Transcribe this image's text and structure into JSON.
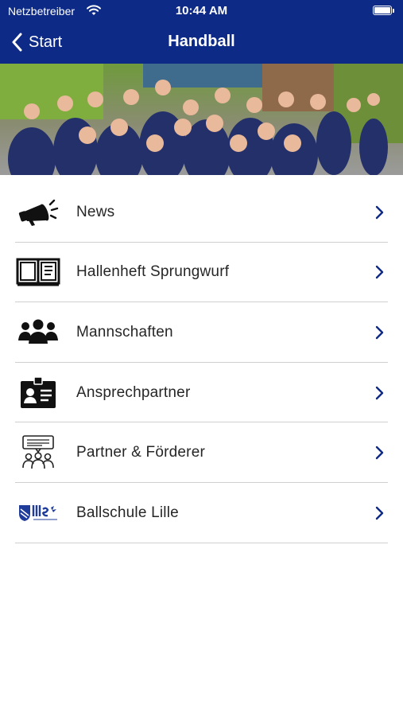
{
  "status_bar": {
    "carrier": "Netzbetreiber",
    "time": "10:44 AM",
    "battery_level": 1.0
  },
  "nav": {
    "back_label": "Start",
    "title": "Handball"
  },
  "hero": {
    "description_icon": "team-photo"
  },
  "colors": {
    "nav_background": "#0d2a86",
    "chevron": "#0d2a86",
    "text": "#262626"
  },
  "menu": [
    {
      "label": "News",
      "icon": "megaphone-icon"
    },
    {
      "label": "Hallenheft Sprungwurf",
      "icon": "open-book-icon"
    },
    {
      "label": "Mannschaften",
      "icon": "team-group-icon"
    },
    {
      "label": "Ansprechpartner",
      "icon": "contact-card-icon"
    },
    {
      "label": "Partner & Förderer",
      "icon": "community-chat-icon"
    },
    {
      "label": "Ballschule Lille",
      "icon": "lille-logo"
    }
  ]
}
